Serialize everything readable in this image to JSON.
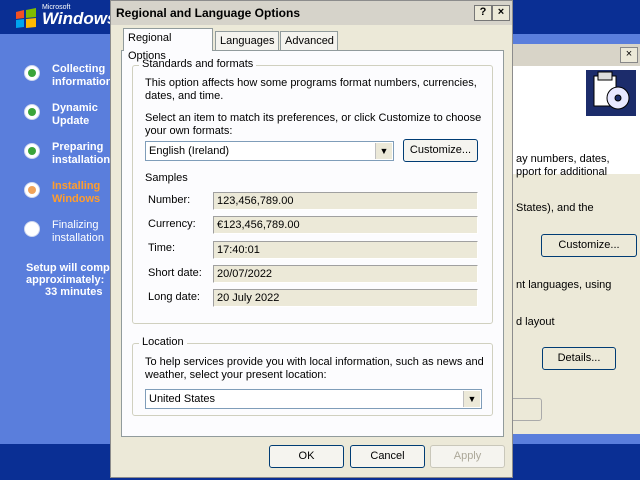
{
  "setup": {
    "logo_small": "Microsoft",
    "logo_text": "Windows",
    "steps": [
      {
        "label": "Collecting information",
        "state": "done"
      },
      {
        "label": "Dynamic Update",
        "state": "done"
      },
      {
        "label": "Preparing installation",
        "state": "done"
      },
      {
        "label": "Installing Windows",
        "state": "current"
      },
      {
        "label": "Finalizing installation",
        "state": "pending"
      }
    ],
    "time_line1": "Setup will comp",
    "time_line2": "approximately:",
    "time_line3": "33 minutes"
  },
  "background_dialog": {
    "close": "×",
    "text1": "ay numbers, dates,",
    "text2": "pport for additional",
    "text3": "States), and the",
    "customize_label": "Customize...",
    "text4": "nt languages, using",
    "text5": "d layout",
    "details_label": "Details..."
  },
  "dialog": {
    "title": "Regional and Language Options",
    "help_label": "?",
    "close_label": "×",
    "tabs": [
      {
        "label": "Regional Options",
        "active": true
      },
      {
        "label": "Languages",
        "active": false
      },
      {
        "label": "Advanced",
        "active": false
      }
    ],
    "standards": {
      "title": "Standards and formats",
      "desc": "This option affects how some programs format numbers, currencies, dates, and time.",
      "select_prompt": "Select an item to match its preferences, or click Customize to choose your own formats:",
      "selected_format": "English (Ireland)",
      "customize_label": "Customize...",
      "samples_title": "Samples",
      "samples": [
        {
          "label": "Number:",
          "value": "123,456,789.00"
        },
        {
          "label": "Currency:",
          "value": "€123,456,789.00"
        },
        {
          "label": "Time:",
          "value": "17:40:01"
        },
        {
          "label": "Short date:",
          "value": "20/07/2022"
        },
        {
          "label": "Long date:",
          "value": "20 July 2022"
        }
      ]
    },
    "location": {
      "title": "Location",
      "desc": "To help services provide you with local information, such as news and weather, select your present location:",
      "selected_location": "United States"
    },
    "buttons": {
      "ok": "OK",
      "cancel": "Cancel",
      "apply": "Apply"
    }
  }
}
